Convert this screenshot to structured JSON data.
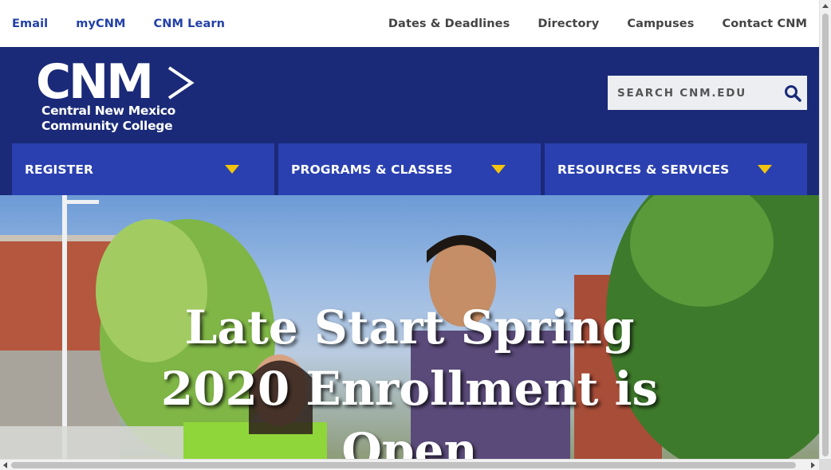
{
  "utility_nav": {
    "left": [
      {
        "label": "Email"
      },
      {
        "label": "myCNM"
      },
      {
        "label": "CNM Learn"
      }
    ],
    "right": [
      {
        "label": "Dates & Deadlines"
      },
      {
        "label": "Directory"
      },
      {
        "label": "Campuses"
      },
      {
        "label": "Contact CNM"
      }
    ]
  },
  "header": {
    "logo_mark": "CNM",
    "logo_line1": "Central New Mexico",
    "logo_line2": "Community College",
    "search_placeholder": "SEARCH CNM.EDU",
    "background_color": "#1a2a78"
  },
  "main_nav": [
    {
      "label": "REGISTER"
    },
    {
      "label": "PROGRAMS & CLASSES"
    },
    {
      "label": "RESOURCES & SERVICES"
    }
  ],
  "hero": {
    "headline_line1": "Late Start Spring",
    "headline_line2": "2020 Enrollment is",
    "headline_line3": "Open"
  },
  "colors": {
    "utility_link": "#2240a8",
    "nav_item_bg": "#2a40b0",
    "nav_arrow": "#f2c40c"
  }
}
